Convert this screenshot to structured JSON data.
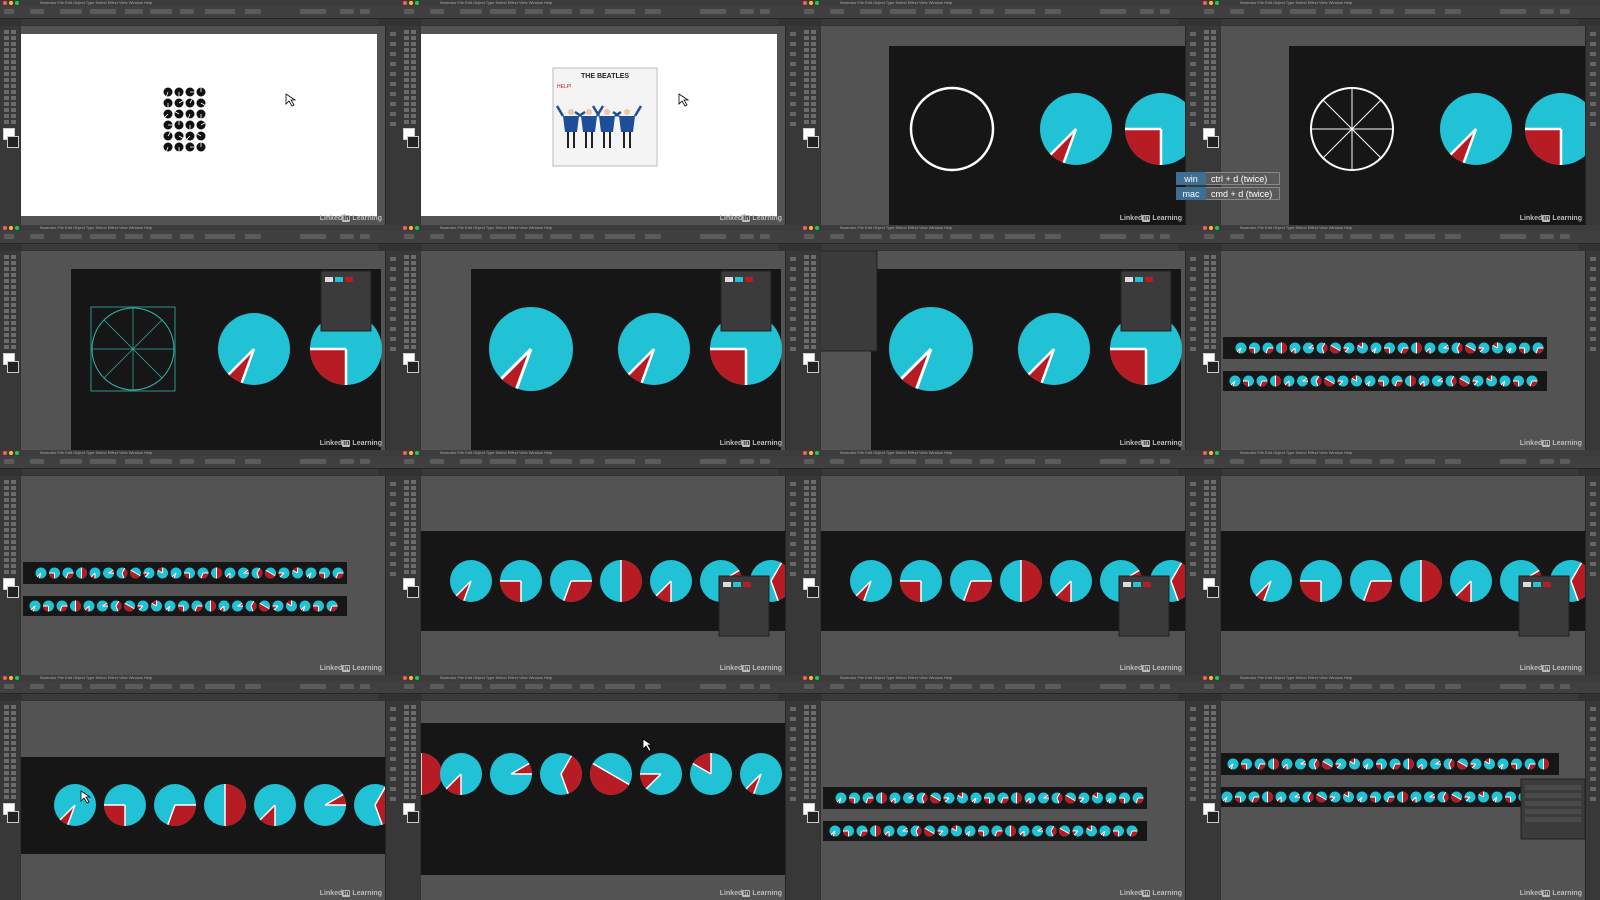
{
  "app": {
    "name": "Adobe Illustrator",
    "menu": [
      "Illustrator",
      "File",
      "Edit",
      "Object",
      "Type",
      "Select",
      "Effect",
      "View",
      "Window",
      "Help"
    ]
  },
  "watermark": {
    "text_pre": "Linked",
    "text_in": "in",
    "text_post": " Learning"
  },
  "shortcut_hint": [
    {
      "platform": "win",
      "keys": "ctrl + d (twice)"
    },
    {
      "platform": "mac",
      "keys": "cmd + d (twice)"
    }
  ],
  "reference": {
    "album_title": "THE BEATLES",
    "album_subtitle": "HELP!"
  },
  "colors": {
    "cyan": "#22c2d6",
    "red": "#b71c24",
    "canvas_dark": "#161616",
    "pasteboard": "#535353",
    "artboard_white": "#ffffff"
  },
  "frames": [
    {
      "id": 1,
      "scene": "reference-grid"
    },
    {
      "id": 2,
      "scene": "beatles-cover"
    },
    {
      "id": 3,
      "scene": "circle-and-pies"
    },
    {
      "id": 4,
      "scene": "wheel-and-pies"
    },
    {
      "id": 5,
      "scene": "selected-wheel"
    },
    {
      "id": 6,
      "scene": "three-pies"
    },
    {
      "id": 7,
      "scene": "three-pies-options"
    },
    {
      "id": 8,
      "scene": "two-rows"
    },
    {
      "id": 9,
      "scene": "two-rows"
    },
    {
      "id": 10,
      "scene": "pie-row"
    },
    {
      "id": 11,
      "scene": "pie-row"
    },
    {
      "id": 12,
      "scene": "pie-row"
    },
    {
      "id": 13,
      "scene": "pie-row-large"
    },
    {
      "id": 14,
      "scene": "pie-row-large-2"
    },
    {
      "id": 15,
      "scene": "two-rows"
    },
    {
      "id": 16,
      "scene": "two-rows-layers"
    }
  ]
}
